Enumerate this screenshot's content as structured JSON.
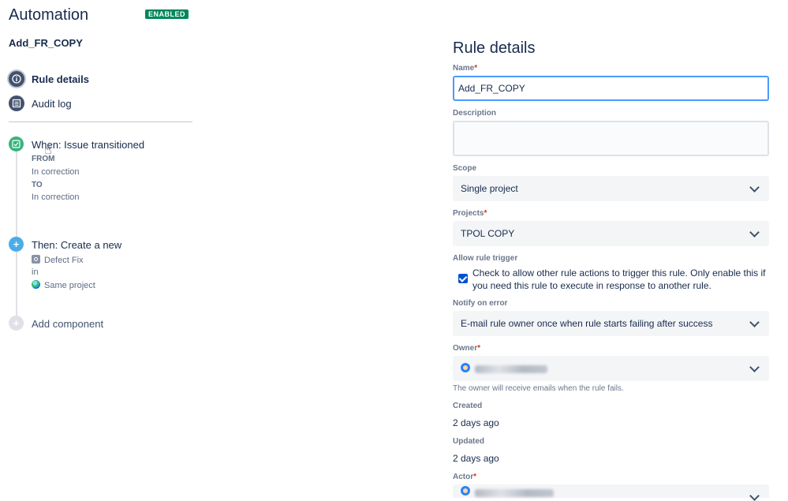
{
  "header": {
    "title": "Automation",
    "status_badge": "ENABLED",
    "rule_name": "Add_FR_COPY"
  },
  "nav": {
    "rule_details": "Rule details",
    "audit_log": "Audit log"
  },
  "components": {
    "trigger": {
      "title": "When: Issue transitioned",
      "from_label": "FROM",
      "from_value": "In correction",
      "to_label": "TO",
      "to_value": "In correction"
    },
    "action": {
      "title": "Then: Create a new",
      "issue_type": "Defect Fix",
      "in_label": "in",
      "project": "Same project"
    },
    "add": {
      "label": "Add component"
    }
  },
  "details": {
    "title": "Rule details",
    "name": {
      "label": "Name",
      "value": "Add_FR_COPY"
    },
    "description": {
      "label": "Description",
      "value": ""
    },
    "scope": {
      "label": "Scope",
      "value": "Single project"
    },
    "projects": {
      "label": "Projects",
      "value": "TPOL COPY"
    },
    "allow_trigger": {
      "label": "Allow rule trigger",
      "text": "Check to allow other rule actions to trigger this rule. Only enable this if you need this rule to execute in response to another rule.",
      "checked": true
    },
    "notify": {
      "label": "Notify on error",
      "value": "E-mail rule owner once when rule starts failing after success"
    },
    "owner": {
      "label": "Owner",
      "helper": "The owner will receive emails when the rule fails."
    },
    "created": {
      "label": "Created",
      "value": "2 days ago"
    },
    "updated": {
      "label": "Updated",
      "value": "2 days ago"
    },
    "actor": {
      "label": "Actor"
    }
  },
  "colors": {
    "enabled": "#00875a",
    "trigger": "#36b37e",
    "action": "#4bade8",
    "focus": "#4c9aff",
    "required": "#de350b"
  }
}
